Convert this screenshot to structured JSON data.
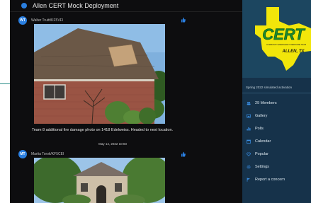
{
  "app": {
    "title": "Allen CERT Mock Deployment"
  },
  "feed": {
    "posts": [
      {
        "avatar_initials": "WT",
        "author": "Walter Truitt/KF5VFI",
        "caption": "Team 8 additional fire damage photo on 1418 Edelweiss. Headed to next location.",
        "timestamp": "May 14, 2022 10:03"
      },
      {
        "avatar_initials": "MT",
        "author": "Martia Torok/KF5CEI"
      }
    ]
  },
  "sidebar": {
    "logo_text": "CERT",
    "logo_subtext": "COMMUNITY EMERGENCY RESPONSE TEAM",
    "logo_location": "ALLEN, TX",
    "group_description": "Spring 2022 simulated activation",
    "nav": [
      {
        "label": "29 Members",
        "icon": "members-icon"
      },
      {
        "label": "Gallery",
        "icon": "gallery-icon"
      },
      {
        "label": "Polls",
        "icon": "polls-icon"
      },
      {
        "label": "Calendar",
        "icon": "calendar-icon"
      },
      {
        "label": "Popular",
        "icon": "heart-icon"
      },
      {
        "label": "Settings",
        "icon": "gear-icon"
      },
      {
        "label": "Report a concern",
        "icon": "flag-icon"
      }
    ]
  },
  "colors": {
    "accent": "#2a7fe0",
    "sidebar_bg": "#16324a",
    "feed_bg": "#0d0d0f",
    "logo_yellow": "#f2e60a",
    "logo_green": "#1a8a2e"
  }
}
